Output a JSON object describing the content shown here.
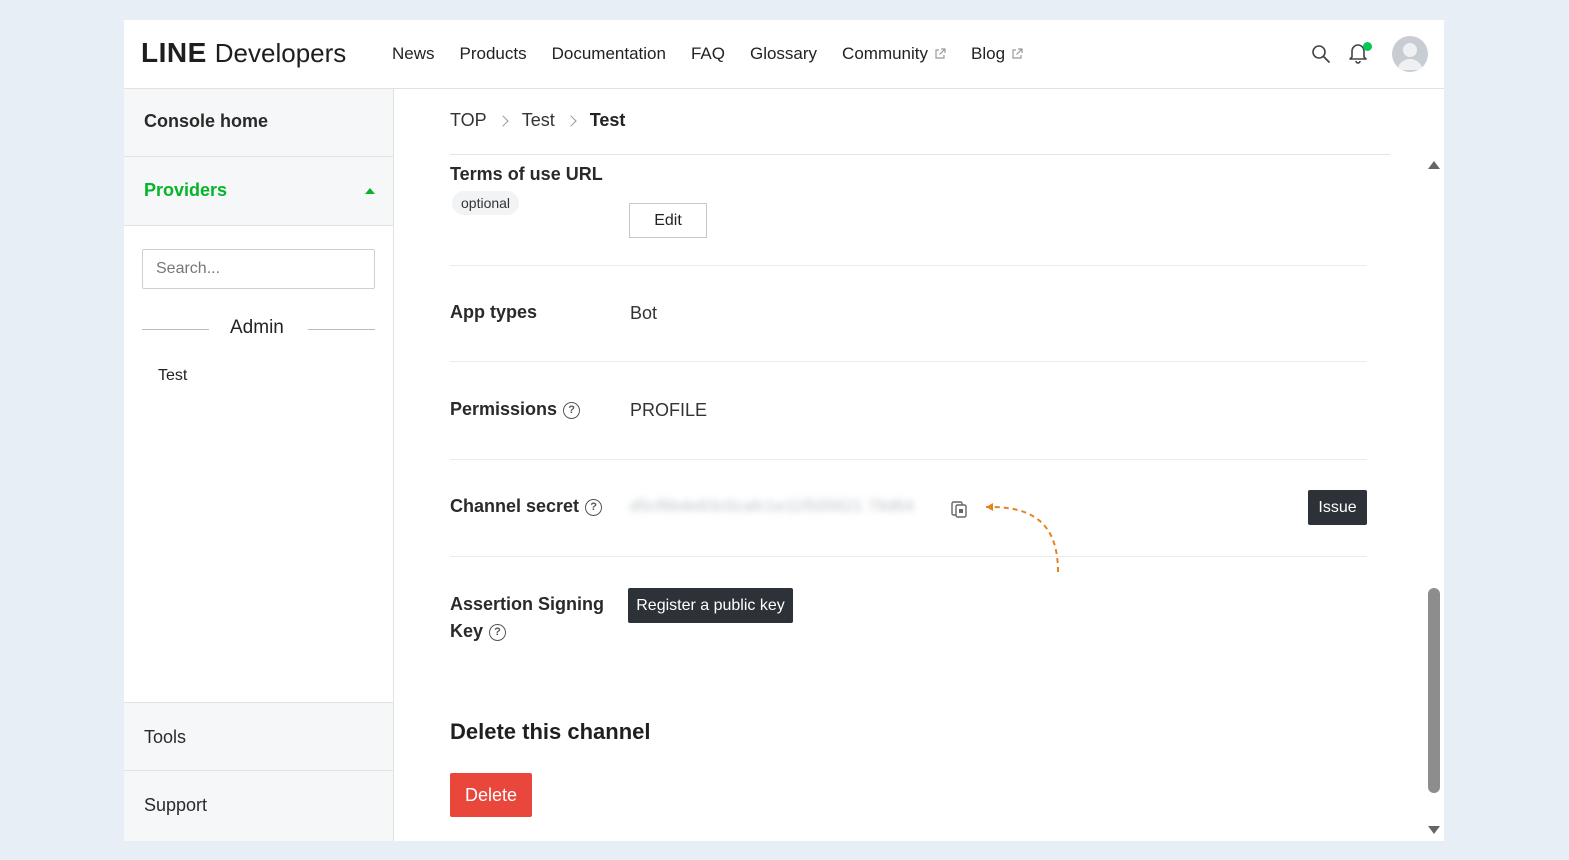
{
  "header": {
    "logo_line": "LINE",
    "logo_developers": "Developers",
    "nav": [
      {
        "label": "News",
        "external": false
      },
      {
        "label": "Products",
        "external": false
      },
      {
        "label": "Documentation",
        "external": false
      },
      {
        "label": "FAQ",
        "external": false
      },
      {
        "label": "Glossary",
        "external": false
      },
      {
        "label": "Community",
        "external": true
      },
      {
        "label": "Blog",
        "external": true
      }
    ],
    "icons": [
      "search-icon",
      "bell-icon",
      "avatar"
    ],
    "notification_dot_color": "#06c755"
  },
  "sidebar": {
    "console_home": "Console home",
    "providers": "Providers",
    "search_placeholder": "Search...",
    "group_label": "Admin",
    "items": [
      {
        "label": "Test"
      }
    ],
    "tools": "Tools",
    "support": "Support",
    "accent_color": "#06b42a"
  },
  "breadcrumb": {
    "items": [
      "TOP",
      "Test",
      "Test"
    ]
  },
  "settings": {
    "terms": {
      "label": "Terms of use URL",
      "badge": "optional",
      "button": "Edit"
    },
    "app_types": {
      "label": "App types",
      "value": "Bot"
    },
    "permissions": {
      "label": "Permissions",
      "value": "PROFILE"
    },
    "channel_secret": {
      "label": "Channel secret",
      "value": "d5cf6b4e63c0cafc1e11f505621 79d64",
      "button": "Issue"
    },
    "assertion": {
      "label_line1": "Assertion Signing",
      "label_line2": "Key",
      "button": "Register a public key"
    }
  },
  "delete": {
    "title": "Delete this channel",
    "button": "Delete",
    "color": "#e9473c"
  }
}
